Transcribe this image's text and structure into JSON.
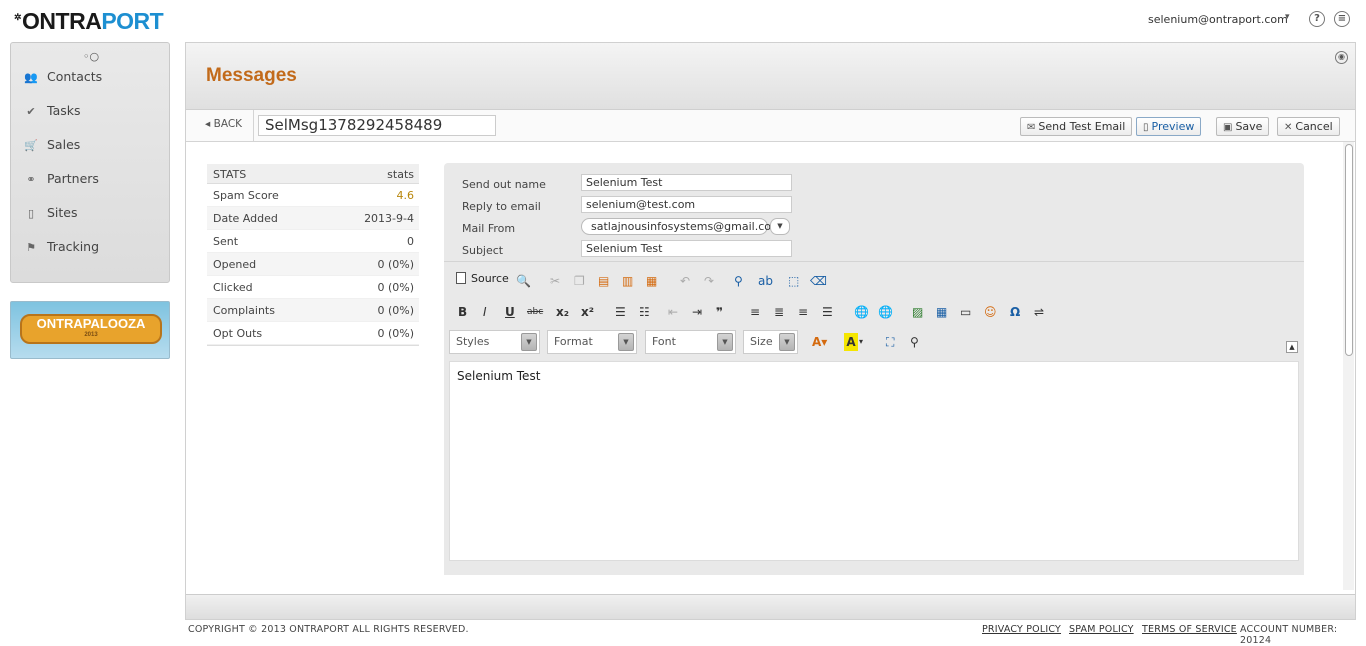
{
  "header": {
    "logo_prefix": "ONTRA",
    "logo_suffix": "PORT",
    "logo_symbol": "✲",
    "user_email": "selenium@ontraport.com",
    "user_caret": "▾",
    "help_glyph": "?",
    "doc_glyph": "≡"
  },
  "sidebar": {
    "toggle_icon": "toggle-icon",
    "items": [
      {
        "label": "Contacts",
        "icon": "contacts-icon",
        "glyph": "👥"
      },
      {
        "label": "Tasks",
        "icon": "checkmark-icon",
        "glyph": "✔"
      },
      {
        "label": "Sales",
        "icon": "cart-icon",
        "glyph": "🛒"
      },
      {
        "label": "Partners",
        "icon": "handshake-icon",
        "glyph": "⚭"
      },
      {
        "label": "Sites",
        "icon": "page-icon",
        "glyph": "▯"
      },
      {
        "label": "Tracking",
        "icon": "flag-icon",
        "glyph": "⚑"
      }
    ],
    "promo_label": "ONTRAPALOOZA",
    "promo_year": "2013"
  },
  "page": {
    "title": "Messages",
    "corner_glyph": "◉"
  },
  "actionbar": {
    "back_label": "BACK",
    "back_glyph": "◂",
    "message_name": "SelMsg1378292458489",
    "buttons": {
      "send_test": "Send Test Email",
      "preview": "Preview",
      "save": "Save",
      "cancel": "Cancel"
    }
  },
  "stats": {
    "header_key": "STATS",
    "header_value": "stats",
    "rows": [
      {
        "key": "Spam Score",
        "value": "4.6"
      },
      {
        "key": "Date Added",
        "value": "2013-9-4"
      },
      {
        "key": "Sent",
        "value": "0"
      },
      {
        "key": "Opened",
        "value": "0 (0%)"
      },
      {
        "key": "Clicked",
        "value": "0 (0%)"
      },
      {
        "key": "Complaints",
        "value": "0 (0%)"
      },
      {
        "key": "Opt Outs",
        "value": "0 (0%)"
      }
    ]
  },
  "form": {
    "send_out_name_label": "Send out name",
    "send_out_name_value": "Selenium Test",
    "reply_to_label": "Reply to email",
    "reply_to_value": "selenium@test.com",
    "mail_from_label": "Mail From",
    "mail_from_value": "satlajnousinfosystems@gmail.com",
    "subject_label": "Subject",
    "subject_value": "Selenium Test"
  },
  "editor": {
    "source_label": "Source",
    "combos": {
      "styles": "Styles",
      "format": "Format",
      "font": "Font",
      "size": "Size"
    },
    "content": "Selenium Test"
  },
  "footer": {
    "copyright": "COPYRIGHT © 2013 ONTRAPORT ALL RIGHTS RESERVED.",
    "privacy": "PRIVACY POLICY",
    "spam": "SPAM POLICY",
    "terms": "TERMS OF SERVICE",
    "account": "ACCOUNT NUMBER: 20124"
  },
  "colors": {
    "title": "#c26a1a",
    "logo_blue": "#1d8fd1",
    "spam_score": "#b8860b"
  }
}
